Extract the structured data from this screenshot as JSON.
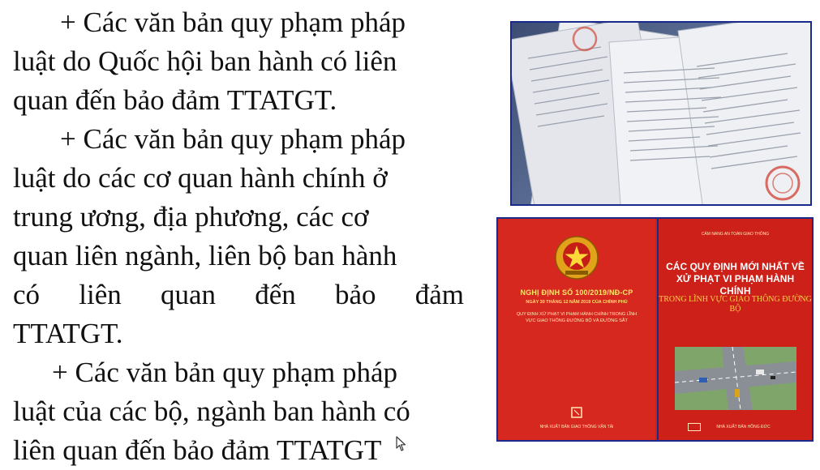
{
  "paragraphs": [
    {
      "lines": [
        "+ Các văn bản quy phạm pháp",
        "luật do Quốc hội ban hành có liên",
        "quan đến bảo đảm TTATGT."
      ]
    },
    {
      "lines": [
        "+ Các văn bản quy phạm pháp",
        "luật do các cơ quan hành chính ở",
        "trung ương, địa phương, các cơ",
        "quan liên ngành, liên bộ ban hành",
        "có liên quan đến bảo đảm",
        "TTATGT."
      ]
    },
    {
      "lines": [
        "+ Các văn bản quy phạm pháp",
        "luật của các bộ, ngành ban hành có",
        "liên quan đến bảo đảm TTATGT"
      ]
    }
  ],
  "images": {
    "documents_photo": {
      "icon": "stacked-legal-documents"
    },
    "books": {
      "left": {
        "title": "NGHỊ ĐỊNH SỐ 100/2019/NĐ-CP",
        "subtitle": "NGÀY 30 THÁNG 12 NĂM 2019 CỦA CHÍNH PHỦ",
        "description": "QUY ĐỊNH XỬ PHẠT VI PHẠM HÀNH CHÍNH TRONG LĨNH VỰC GIAO THÔNG ĐƯỜNG BỘ VÀ ĐƯỜNG SẮT",
        "publisher": "NHÀ XUẤT BẢN GIAO THÔNG VẬN TẢI"
      },
      "right": {
        "top_line": "CẨM NANG AN TOÀN GIAO THÔNG",
        "headline": "CÁC QUY ĐỊNH MỚI NHẤT VỀ XỬ PHẠT VI PHẠM HÀNH CHÍNH",
        "field": "TRONG LĨNH VỰC GIAO THÔNG ĐƯỜNG BỘ",
        "publisher": "NHÀ XUẤT BẢN HỒNG ĐỨC"
      }
    }
  },
  "colors": {
    "text": "#111111",
    "frame": "#1a2a8a",
    "book_red": "#d6281f",
    "book_yellow": "#ffe36b"
  }
}
